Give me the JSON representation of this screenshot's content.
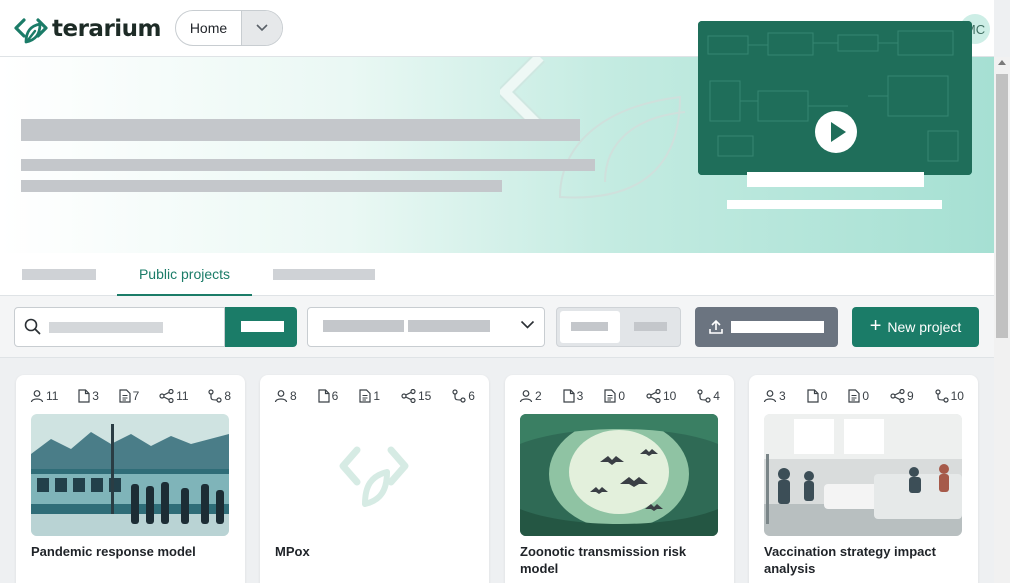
{
  "header": {
    "brand": "terarium",
    "nav_selected": "Home",
    "avatar_initials": "MC"
  },
  "tabs": {
    "active_label": "Public projects"
  },
  "toolbar": {
    "new_project_label": "New project"
  },
  "projects": [
    {
      "title": "Pandemic response model",
      "stats": {
        "contributors": "11",
        "papers": "3",
        "documents": "7",
        "models": "11",
        "workflows": "8"
      }
    },
    {
      "title": "MPox",
      "stats": {
        "contributors": "8",
        "papers": "6",
        "documents": "1",
        "models": "15",
        "workflows": "6"
      }
    },
    {
      "title": "Zoonotic transmission risk model",
      "stats": {
        "contributors": "2",
        "papers": "3",
        "documents": "0",
        "models": "10",
        "workflows": "4"
      }
    },
    {
      "title": "Vaccination strategy impact analysis",
      "stats": {
        "contributors": "3",
        "papers": "0",
        "documents": "0",
        "models": "9",
        "workflows": "10"
      }
    }
  ],
  "colors": {
    "accent": "#1b7c68",
    "upload_button": "#6b7480"
  }
}
